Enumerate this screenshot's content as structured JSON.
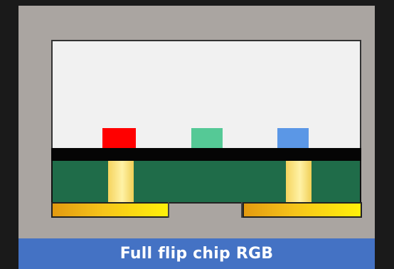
{
  "caption": "Full flip chip RGB",
  "colors": {
    "background": "#1a1a1a",
    "frame": "#aaa5a1",
    "white_area": "#f1f1f1",
    "black_band": "#050505",
    "green_board": "#1f6c49",
    "via_gold": "#f5d45e",
    "pad_gold": "#f6c51a",
    "caption_bar": "#4472c4",
    "caption_text": "#ffffff"
  },
  "chips": [
    {
      "name": "red-chip",
      "color": "#ff0000"
    },
    {
      "name": "green-chip",
      "color": "#55c996"
    },
    {
      "name": "blue-chip",
      "color": "#5b97e6"
    }
  ]
}
